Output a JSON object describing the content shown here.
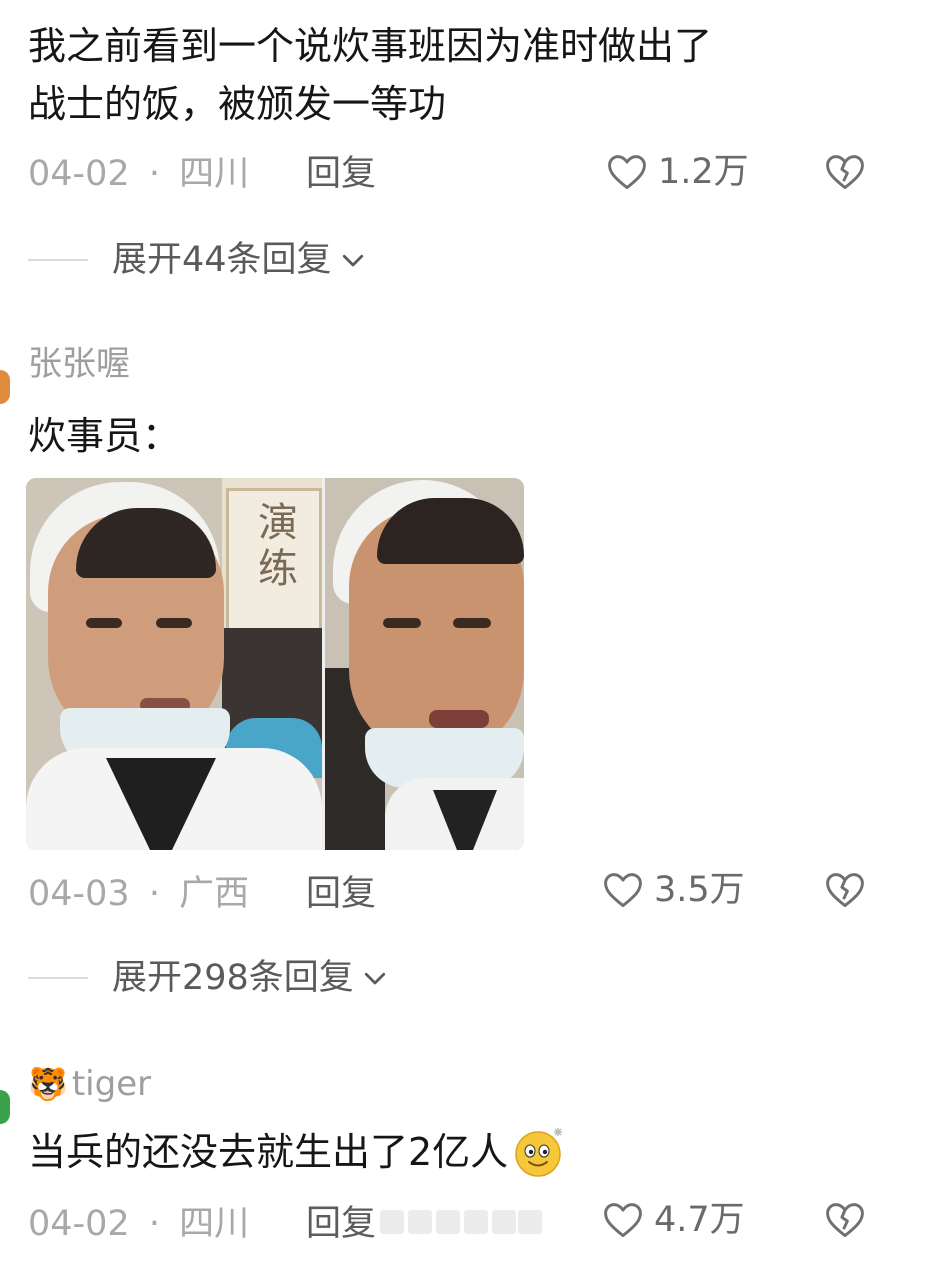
{
  "comments": [
    {
      "text_line1": "我之前看到一个说炊事班因为准时做出了",
      "text_line2": "战士的饭，被颁发一等功",
      "date": "04-02",
      "location": "四川",
      "reply_label": "回复",
      "likes": "1.2万",
      "expand_label": "展开44条回复"
    },
    {
      "username": "张张喔",
      "text": "炊事员：",
      "image_watermark": "演练",
      "date": "04-03",
      "location": "广西",
      "reply_label": "回复",
      "likes": "3.5万",
      "expand_label": "展开298条回复"
    },
    {
      "username": "tiger",
      "username_emoji": "🐯",
      "text": "当兵的还没去就生出了2亿人",
      "date": "04-02",
      "location": "四川",
      "reply_label": "回复",
      "likes": "4.7万"
    }
  ],
  "meta_separator": "·",
  "colors": {
    "text": "#161616",
    "meta": "#a8a8a8",
    "icon": "#707070",
    "avatar_orange": "#e08a3c",
    "avatar_green": "#3aa04a"
  },
  "icons": [
    "heart-outline-icon",
    "broken-heart-icon",
    "chevron-down-icon",
    "smiley-emoji-icon"
  ]
}
